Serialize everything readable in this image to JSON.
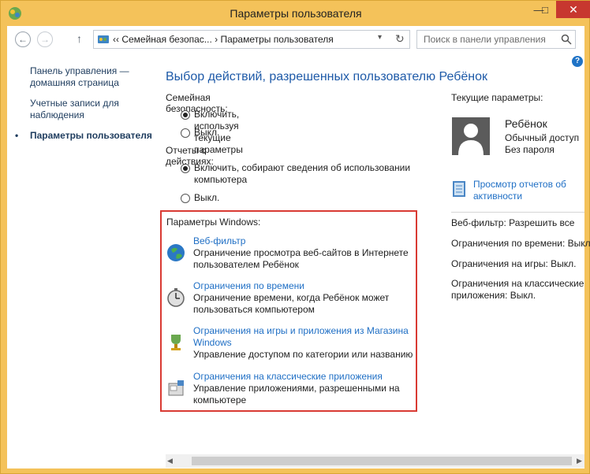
{
  "window": {
    "title": "Параметры пользователя",
    "minimize_glyph": "—",
    "maximize_glyph": "□",
    "close_glyph": "✕"
  },
  "navbar": {
    "back_glyph": "←",
    "forward_glyph": "→",
    "up_glyph": "↑",
    "address": "‹‹  Семейная безопас...  ›  Параметры пользователя",
    "dropdown_glyph": "▾",
    "refresh_glyph": "↻",
    "search_placeholder": "Поиск в панели управления"
  },
  "help_glyph": "?",
  "left_nav": {
    "home_link": "Панель управления — домашняя страница",
    "accounts_link": "Учетные записи для наблюдения",
    "current": "Параметры пользователя",
    "bullet": "•"
  },
  "main": {
    "heading": "Выбор действий, разрешенных пользователю Ребёнок",
    "family_safety_label": "Семейная безопасность:",
    "family_on": "Включить, используя текущие параметры",
    "family_off": "Выкл.",
    "reports_label": "Отчеты о действиях:",
    "reports_on": "Включить, собирают сведения об использовании компьютера",
    "reports_off": "Выкл."
  },
  "windows_settings": {
    "title": "Параметры Windows:",
    "items": [
      {
        "icon": "globe-icon",
        "link": "Веб-фильтр",
        "desc": "Ограничение просмотра веб-сайтов в Интернете пользователем Ребёнок"
      },
      {
        "icon": "stopwatch-icon",
        "link": "Ограничения по времени",
        "desc": "Ограничение времени, когда Ребёнок может пользоваться компьютером"
      },
      {
        "icon": "trophy-icon",
        "link": "Ограничения на игры и приложения из Магазина Windows",
        "desc": "Управление доступом по категории или названию"
      },
      {
        "icon": "app-restrict-icon",
        "link": "Ограничения на классические приложения",
        "desc": "Управление приложениями, разрешенными на компьютере"
      }
    ]
  },
  "right_panel": {
    "title": "Текущие параметры:",
    "user_name": "Ребёнок",
    "user_type": "Обычный доступ",
    "user_password": "Без пароля",
    "report_link": "Просмотр отчетов об активности",
    "web_filter": "Веб-фильтр: Разрешить все",
    "time_limits": "Ограничения по времени: Выкл.",
    "game_limits": "Ограничения на игры: Выкл.",
    "app_limits": "Ограничения на классические приложения: Выкл."
  },
  "scrollbar": {
    "left_glyph": "◀",
    "right_glyph": "▶"
  },
  "colors": {
    "accent": "#1f6fc5",
    "highlight_border": "#d93a33",
    "frame": "#f4c25a"
  }
}
